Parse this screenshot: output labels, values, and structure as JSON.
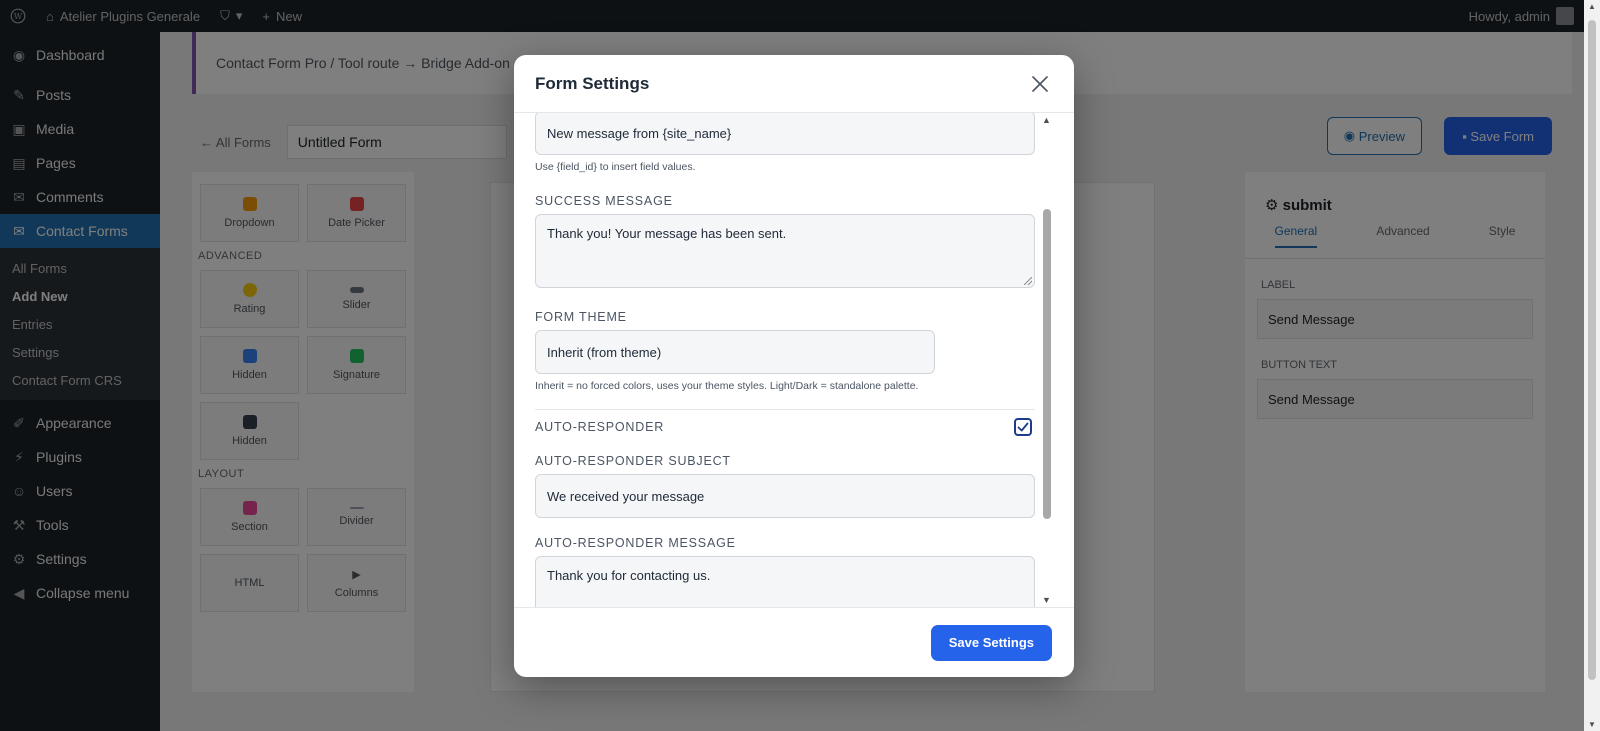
{
  "adminbar": {
    "site_name": "Atelier Plugins Generale",
    "new_label": "New",
    "greeting": "Howdy, admin"
  },
  "adminmenu": {
    "items": [
      {
        "label": "Dashboard",
        "icon": "dashboard-icon"
      },
      {
        "label": "Posts",
        "icon": "pin-icon"
      },
      {
        "label": "Media",
        "icon": "media-icon"
      },
      {
        "label": "Pages",
        "icon": "page-icon"
      },
      {
        "label": "Comments",
        "icon": "comment-icon"
      },
      {
        "label": "Contact Forms",
        "icon": "mail-icon"
      }
    ],
    "submenu": [
      "All Forms",
      "Add New",
      "Entries",
      "Settings",
      "Contact Form CRS"
    ],
    "items_after": [
      {
        "label": "Appearance",
        "icon": "brush-icon"
      },
      {
        "label": "Plugins",
        "icon": "plugin-icon"
      },
      {
        "label": "Users",
        "icon": "users-icon"
      },
      {
        "label": "Tools",
        "icon": "wrench-icon"
      },
      {
        "label": "Settings",
        "icon": "settings-icon"
      },
      {
        "label": "Collapse menu",
        "icon": "collapse-icon"
      }
    ]
  },
  "background": {
    "breadcrumb": "Contact Form Pro / Tool route → Bridge Add-on",
    "back_link": "← All Forms",
    "form_title": "Untitled Form",
    "preview_label": "Preview",
    "save_form_label": "Save Form",
    "palette_groups": [
      "ADVANCED",
      "LAYOUT"
    ],
    "palette_fields_top": [
      "Dropdown",
      "Date Picker"
    ],
    "palette_fields_advanced": [
      "Rating",
      "Slider",
      "Hidden",
      "Signature",
      "Hidden"
    ],
    "palette_fields_layout": [
      "Section",
      "Divider",
      "HTML",
      "Columns"
    ],
    "inspector_title": "submit",
    "inspector_tabs": [
      "General",
      "Advanced",
      "Style"
    ],
    "inspector_label1": "LABEL",
    "inspector_value1": "Send Message",
    "inspector_label2": "BUTTON TEXT",
    "inspector_value2": "Send Message"
  },
  "modal": {
    "title": "Form Settings",
    "email_subject_value": "New message from {site_name}",
    "email_subject_hint": "Use {field_id} to insert field values.",
    "success_label": "SUCCESS MESSAGE",
    "success_value": "Thank you! Your message has been sent.",
    "theme_label": "FORM THEME",
    "theme_value": "Inherit (from theme)",
    "theme_hint": "Inherit = no forced colors, uses your theme styles. Light/Dark = standalone palette.",
    "autoresponder_label": "AUTO-RESPONDER",
    "autoresponder_checked": true,
    "ar_subject_label": "AUTO-RESPONDER SUBJECT",
    "ar_subject_value": "We received your message",
    "ar_message_label": "AUTO-RESPONDER MESSAGE",
    "ar_message_value": "Thank you for contacting us.",
    "save_label": "Save Settings"
  },
  "colors": {
    "accent": "#2563eb",
    "overlay": "rgba(0,0,0,0.5)",
    "checkbox_border": "#1e3a8a"
  }
}
